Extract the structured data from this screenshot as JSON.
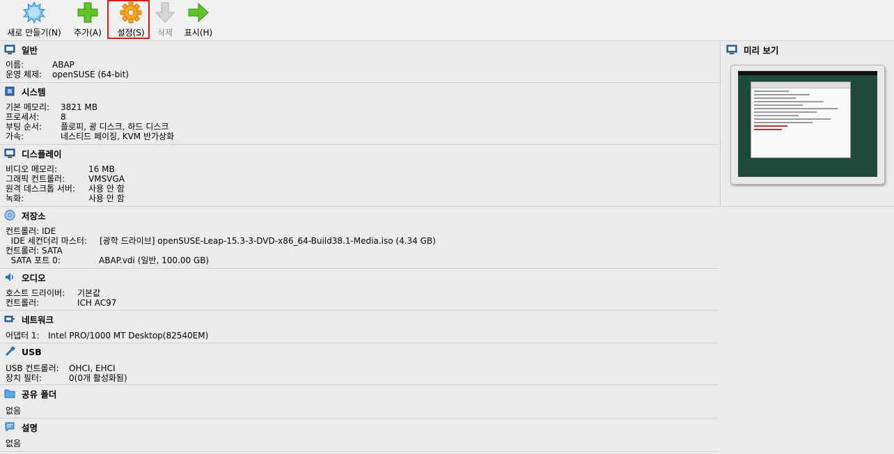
{
  "toolbar": {
    "buttons": [
      {
        "label": "새로 만들기(N)",
        "icon": "new-machine-icon",
        "enabled": true
      },
      {
        "label": "추가(A)",
        "icon": "add-plus-icon",
        "enabled": true
      },
      {
        "label": "설정(S)",
        "icon": "settings-gear-icon",
        "enabled": true,
        "highlighted": true
      },
      {
        "label": "삭제",
        "icon": "discard-arrow-icon",
        "enabled": false
      },
      {
        "label": "표시(H)",
        "icon": "show-arrow-icon",
        "enabled": true
      }
    ],
    "highlight_color": "#e01818"
  },
  "details": {
    "general": {
      "title": "일반",
      "rows": [
        {
          "key": "이름:",
          "value": "ABAP"
        },
        {
          "key": "운영 체제:",
          "value": "openSUSE (64-bit)"
        }
      ]
    },
    "system": {
      "title": "시스템",
      "rows": [
        {
          "key": "기본 메모리:",
          "value": "3821 MB"
        },
        {
          "key": "프로세서:",
          "value": "8"
        },
        {
          "key": "부팅 순서:",
          "value": "플로피, 광 디스크, 하드 디스크"
        },
        {
          "key": "가속:",
          "value": "네스티드 페이징, KVM 반가상화"
        }
      ]
    },
    "display": {
      "title": "디스플레이",
      "rows": [
        {
          "key": "비디오 메모리:",
          "value": "16 MB"
        },
        {
          "key": "그래픽 컨트롤러:",
          "value": "VMSVGA"
        },
        {
          "key": "원격 데스크톱 서버:",
          "value": "사용 안 함"
        },
        {
          "key": "녹화:",
          "value": "사용 안 함"
        }
      ]
    },
    "storage": {
      "title": "저장소",
      "rows": [
        {
          "key": "컨트롤러: IDE",
          "value": ""
        },
        {
          "key": "  IDE 세컨더리 마스터:",
          "value": "[광학 드라이브] openSUSE-Leap-15.3-3-DVD-x86_64-Build38.1-Media.iso (4.34 GB)"
        },
        {
          "key": "컨트롤러: SATA",
          "value": ""
        },
        {
          "key": "  SATA 포트 0:",
          "value": "ABAP.vdi (일반, 100.00 GB)"
        }
      ]
    },
    "audio": {
      "title": "오디오",
      "rows": [
        {
          "key": "호스트 드라이버:",
          "value": "기본값"
        },
        {
          "key": "컨트롤러:",
          "value": "ICH AC97"
        }
      ]
    },
    "network": {
      "title": "네트워크",
      "rows": [
        {
          "key": "어댑터 1:",
          "value": "Intel PRO/1000 MT Desktop(82540EM)"
        }
      ]
    },
    "usb": {
      "title": "USB",
      "rows": [
        {
          "key": "USB 컨트롤러:",
          "value": "OHCI, EHCI"
        },
        {
          "key": "장치 필터:",
          "value": "0(0개 활성화됨)"
        }
      ]
    },
    "shared_folders": {
      "title": "공유 폴더",
      "rows": [
        {
          "key": "없음",
          "value": ""
        }
      ]
    },
    "description": {
      "title": "설명",
      "rows": [
        {
          "key": "없음",
          "value": ""
        }
      ]
    }
  },
  "preview": {
    "title": "미리 보기"
  }
}
